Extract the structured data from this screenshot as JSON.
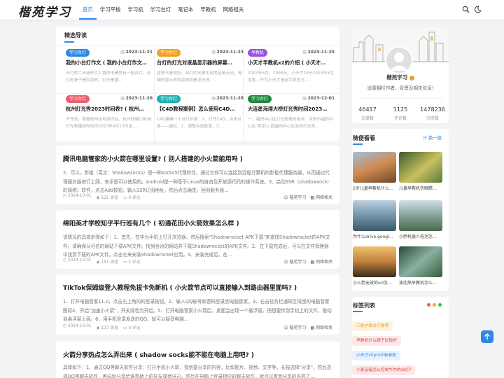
{
  "header": {
    "logo": "楷苑学习",
    "nav": [
      "首页",
      "学习平板",
      "学习机",
      "学习台灯",
      "笔记本",
      "早教机",
      "网络相关"
    ],
    "active_nav": "首页",
    "icons": [
      "search-icon",
      "theme-toggle-icon"
    ]
  },
  "featured": {
    "title": "精选导读",
    "items": [
      {
        "badge": "学习台灯",
        "badge_color": "#2f88e8",
        "date": "2023-11-21",
        "title": "我的小台灯作文 ( 我的小台灯作文…",
        "desc": "台灯的二年级作文1 我的书桌旁有一座台灯，台灯的身子是红色的，灯头是银…"
      },
      {
        "badge": "学习台灯",
        "badge_color": "#f0a020",
        "date": "2023-11-23",
        "title": "台灯的灯光对液晶显示器的屏幕…",
        "desc": "这样不是很好。台灯的光源太弱而且是点光。电脑的显示屏发亮面而是发光体，…"
      },
      {
        "badge": "早教机",
        "badge_color": "#9b50e0",
        "date": "2023-11-25",
        "title": "小天才早教机x2的介绍 ( 小天才…",
        "desc": "2023年5月，1999元。小天才19于2023年5月发售，作为小天才电话手表官方…"
      },
      {
        "badge": "学习台灯",
        "badge_color": "#f05a6a",
        "date": "2023-11-26",
        "title": "杭州灯光秀2023时间表? ( 杭州…",
        "desc": "不开放。根据杭州本地资讯站，杭州钱塘江新城灯光秀播放时间为2023年9月13日至…"
      },
      {
        "badge": "学习台灯",
        "badge_color": "#20b2b0",
        "date": "2023-11-28",
        "title": "【C4D教程案例】怎么使用C4D…",
        "desc": "C4D建模一个台灯步骤：1、打开C4D，点击对象——圆柱；2、调整合适数值；3、…"
      },
      {
        "badge": "学习台灯",
        "badge_color": "#1a8a3a",
        "date": "2023-12-01",
        "title": "大连星海湾大桥灯光秀时间2023…",
        "desc": "一、福田中心区灯光秀展览地点：深圳市福田中心区 莲花山 园福田中心区亲亲灯光秀…"
      }
    ]
  },
  "posts": [
    {
      "title": "腾讯电脑管家的小火箭在哪里设置? ( 别人搭建的小火箭能用吗 )",
      "excerpt": "2、可以。影梭（英文：Shadowsocks）是一种socks5代理软件，通过它你可以连接到远程计算机的影梭代理服务器，从而通过代理服务器进行上网，安卓是可以使用的。Android是一种基于Linux的自由及开放源代码的操作系统。3、启动SSR（shadowsockr的简称）软件，点击Add按钮，输入SSR订阅地址，然后点击确定。回到服务器…",
      "date": "2024-10-01",
      "views": "121 浏览",
      "comments": "0 评论",
      "author": "楷苑学习",
      "category": "网络相关"
    },
    {
      "title": "绵阳英才学校知乎平行班有几个 ( 初通花田小火箭效果怎么样 )",
      "excerpt": "该情况的具体步骤如下：1、首先，在华为手机上打开浏览器，然后搜索\"Shadowrocket APK下载\"来查找Shadowrocket的APK文件。请确保从可信的网站下载APK文件。找到合适的网站并下载Shadowrocket的APK文件。2、在下载完成后，可以在文件管理器中找到下载的APK文件。点击它来安装Shadowrocket应用。3、安装完成后，在…",
      "date": "2024-10-01",
      "views": "151 浏览",
      "comments": "2 评论",
      "author": "楷苑学习",
      "category": "网络相关"
    },
    {
      "title": "TikTok保姆级登入教程免拔卡免新机 ( 小火箭节点可以直接输入到路由器里面吗? )",
      "excerpt": "1、打开电脑管家11.0，点击左上角的的登录按钮。2、输入QQ帐号和密码登录到电脑管家。3、右击任务栏通知区域里的电脑管家图标4、开启\"加速小火箭\"，开关绿色为开启。5、打开电脑管家小火箭后，桌面会出现一个悬浮窗，把想要传到手机上的文件，拖动到悬浮窗上面。6、用手机登录发送的QQ，就可以接受电脑…",
      "date": "2024-10-01",
      "views": "137 浏览",
      "comments": "0 评论",
      "author": "楷苑学习",
      "category": "网络相关"
    },
    {
      "title": "火箭分享热点怎么弄出来 ( shadow socks能不能在电脑上用吧? )",
      "excerpt": "具体如下：1、通过QQ等聊天软件分享：打开手机小火箭，找到要分享的内容，比如图片、视频、文字等，长按选择\"分享\"，然后选择QQ等聊天软件，再向你分享给谁帮助上的好友或者自己。然后在电脑上登录相应的聊天软件，就可以看到分享的内容了…",
      "date": "",
      "views": "",
      "comments": "",
      "author": "",
      "category": ""
    }
  ],
  "profile": {
    "name": "楷苑学习",
    "desc": "设置朝栏作者、背景及相关信息!",
    "stats": [
      {
        "n": "46417",
        "l": "文章数"
      },
      {
        "n": "1125",
        "l": "评论数"
      },
      {
        "n": "1478236",
        "l": "浏览数"
      }
    ]
  },
  "recommend": {
    "title": "随便看看",
    "refresh": "换一换",
    "items": [
      {
        "caption": "2岁儿童早教机什么…",
        "color": "#c06a3a"
      },
      {
        "caption": "儿童早教机伤眼睛…",
        "color": "#6a8a3a"
      },
      {
        "caption": "为什么drive.googl…",
        "color": "#4a7a9a"
      },
      {
        "caption": "小胖机器人电池怎…",
        "color": "#5a8a4a"
      },
      {
        "caption": "小火箭无效的url怎…",
        "color": "#c8863a"
      },
      {
        "caption": "波比熊早教机怎么…",
        "color": "#4a7a5a"
      }
    ]
  },
  "tags": {
    "title": "标签列表",
    "items": [
      {
        "label": "三款护眼台灯推荐",
        "color": "#f0a020",
        "bg": "#fdf3e0"
      },
      {
        "label": "早教机什么牌子比较好",
        "color": "#e04040",
        "bg": "#fde8e8"
      },
      {
        "label": "小天才x5pro平板参数",
        "color": "#2f88e8",
        "bg": "#e8f1fd"
      },
      {
        "label": "小麦音箱怎么控制华为的台灯?",
        "color": "#e04040",
        "bg": "#fde8e8"
      }
    ]
  }
}
